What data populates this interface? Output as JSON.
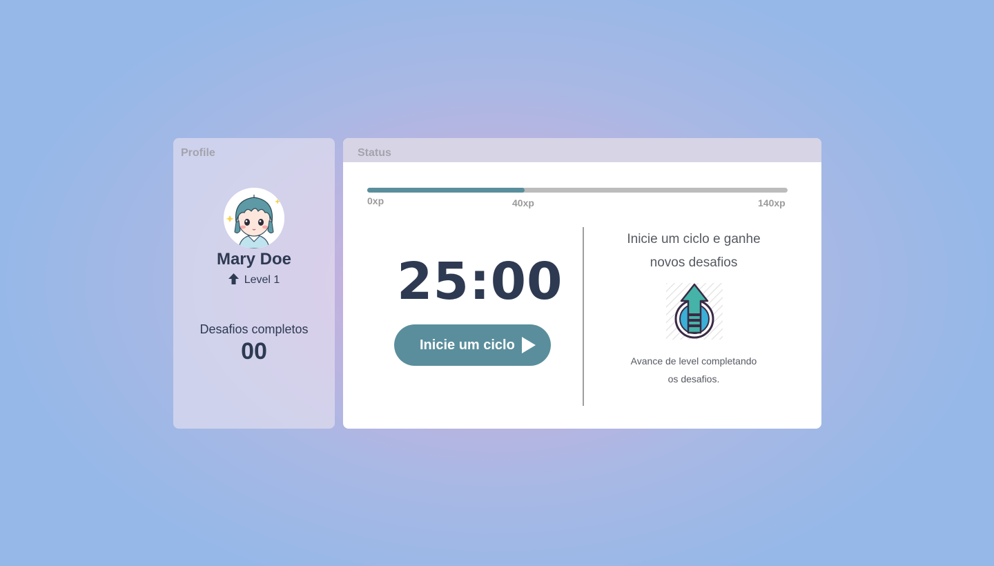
{
  "profile": {
    "title": "Profile",
    "name": "Mary Doe",
    "level": "Level 1",
    "challenges_label": "Desafios completos",
    "challenges_count": "00"
  },
  "status": {
    "title": "Status",
    "xp": {
      "min_label": "0xp",
      "current_label": "40xp",
      "max_label": "140xp",
      "progress_fraction": 0.375
    },
    "timer": "25:00",
    "start_button_label": "Inicie um ciclo",
    "promo": {
      "title_line1": "Inicie um ciclo e ganhe",
      "title_line2": "novos desafios",
      "text_line1": "Avance de level completando",
      "text_line2": "os desafios."
    }
  },
  "icons": [
    "avatar-girl-icon",
    "level-up-arrow-icon",
    "play-icon",
    "level-up-badge-icon"
  ],
  "colors": {
    "accent": "#5a8e9c",
    "text_dark": "#2e3a52",
    "muted_title": "#a3a3ad",
    "track": "#bcbcbc"
  }
}
